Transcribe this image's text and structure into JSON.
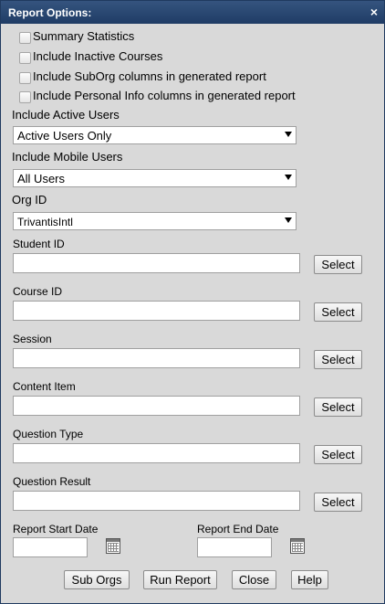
{
  "dialog": {
    "title": "Report Options:",
    "close_glyph": "×"
  },
  "checkboxes": [
    {
      "label": "Summary Statistics"
    },
    {
      "label": "Include Inactive Courses"
    },
    {
      "label": "Include SubOrg columns in generated report"
    },
    {
      "label": "Include Personal Info columns in generated report"
    }
  ],
  "active_users": {
    "label": "Include Active Users",
    "value": "Active Users Only"
  },
  "mobile_users": {
    "label": "Include Mobile Users",
    "value": "All Users"
  },
  "org_id": {
    "label": "Org ID",
    "value": "TrivantisIntl"
  },
  "fields": [
    {
      "label": "Student ID",
      "value": "",
      "button": "Select"
    },
    {
      "label": "Course ID",
      "value": "",
      "button": "Select"
    },
    {
      "label": "Session",
      "value": "",
      "button": "Select"
    },
    {
      "label": "Content Item",
      "value": "",
      "button": "Select"
    },
    {
      "label": "Question Type",
      "value": "",
      "button": "Select"
    },
    {
      "label": "Question Result",
      "value": "",
      "button": "Select"
    }
  ],
  "dates": {
    "start_label": "Report Start Date",
    "start_value": "",
    "end_label": "Report End Date",
    "end_value": ""
  },
  "footer": {
    "sub_orgs": "Sub Orgs",
    "run_report": "Run Report",
    "close": "Close",
    "help": "Help"
  }
}
